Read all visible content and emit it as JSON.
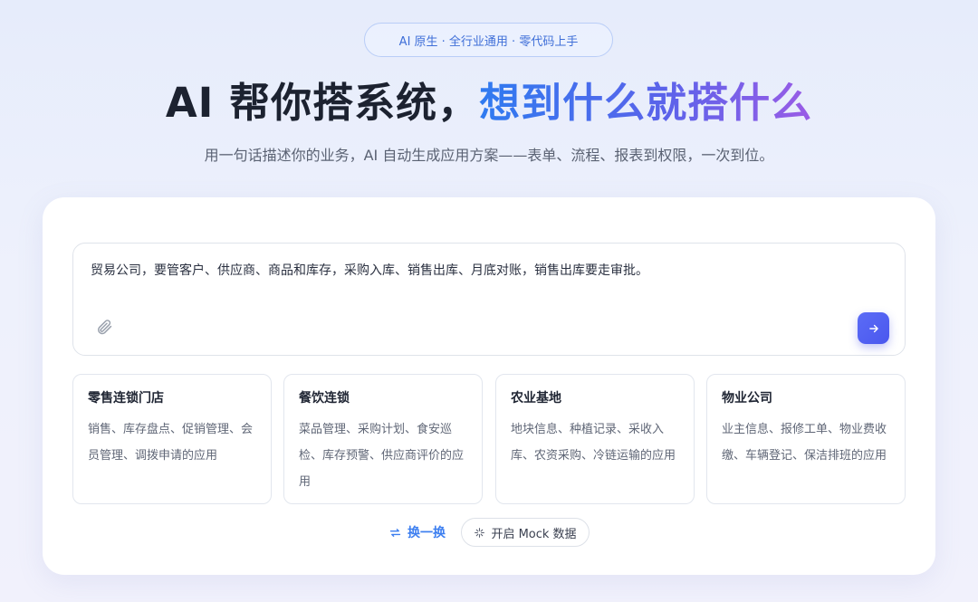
{
  "badge": {
    "text": "AI 原生 · 全行业通用 · 零代码上手"
  },
  "headline": {
    "plain": "AI 帮你搭系统，",
    "highlight": "想到什么就搭什么"
  },
  "subline": "用一句话描述你的业务，AI 自动生成应用方案——表单、流程、报表到权限，一次到位。",
  "prompt": {
    "value": "贸易公司，要管客户、供应商、商品和库存，采购入库、销售出库、月底对账，销售出库要走审批。"
  },
  "icons": {
    "attach": "paperclip-icon",
    "send": "arrow-right-icon",
    "shuffle": "shuffle-icon",
    "mock": "sparkle-icon"
  },
  "templates": [
    {
      "title": "零售连锁门店",
      "desc": "销售、库存盘点、促销管理、会员管理、调拨申请的应用"
    },
    {
      "title": "餐饮连锁",
      "desc": "菜品管理、采购计划、食安巡检、库存预警、供应商评价的应用"
    },
    {
      "title": "农业基地",
      "desc": "地块信息、种植记录、采收入库、农资采购、冷链运输的应用"
    },
    {
      "title": "物业公司",
      "desc": "业主信息、报修工单、物业费收缴、车辆登记、保洁排班的应用"
    }
  ],
  "actions": {
    "shuffle_label": "换一换",
    "mock_label": "开启 Mock 数据"
  },
  "colors": {
    "accent": "#4a57ee",
    "link": "#3d7ff0",
    "gradient_start": "#2f7bf0",
    "gradient_end": "#9a5ce6"
  }
}
